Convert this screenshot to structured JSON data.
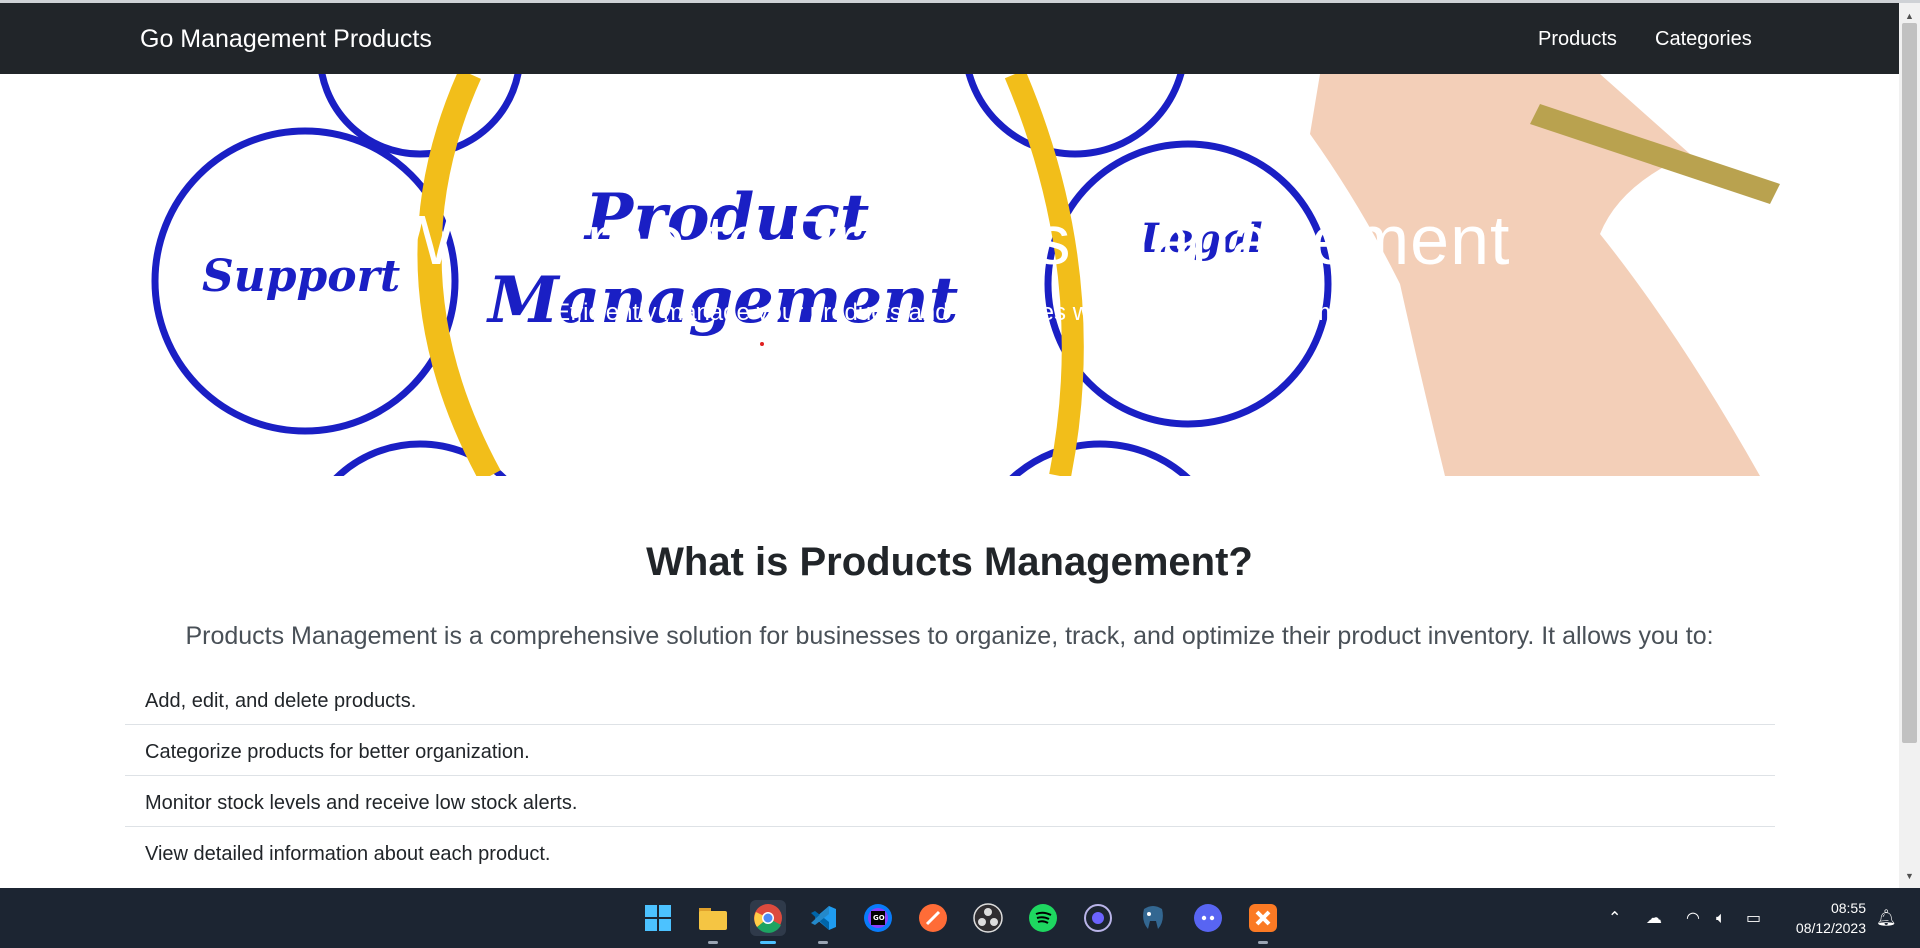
{
  "navbar": {
    "brand": "Go Management Products",
    "links": [
      {
        "label": "Products"
      },
      {
        "label": "Categories"
      }
    ]
  },
  "hero": {
    "title": "Welcome to Products Management",
    "subtitle": "Efficiently manage your products and categories with our intuitive platform.",
    "image_words": [
      "Support",
      "Product",
      "Management",
      "Legal"
    ]
  },
  "about": {
    "title": "What is Products Management?",
    "lead": "Products Management is a comprehensive solution for businesses to organize, track, and optimize their product inventory. It allows you to:",
    "features": [
      "Add, edit, and delete products.",
      "Categorize products for better organization.",
      "Monitor stock levels and receive low stock alerts.",
      "View detailed information about each product."
    ]
  },
  "taskbar": {
    "apps": [
      "windows-start",
      "file-explorer",
      "chrome",
      "vscode",
      "goland",
      "postman",
      "obs-studio",
      "spotify",
      "beekeeper",
      "pgadmin",
      "discord",
      "xampp"
    ],
    "clock": {
      "time": "08:55",
      "date": "08/12/2023"
    }
  },
  "colors": {
    "navbar_bg": "#212529",
    "taskbar_bg": "#1c2532",
    "hero_blue": "#1a1fc4",
    "hero_yellow": "#f2be1a"
  }
}
